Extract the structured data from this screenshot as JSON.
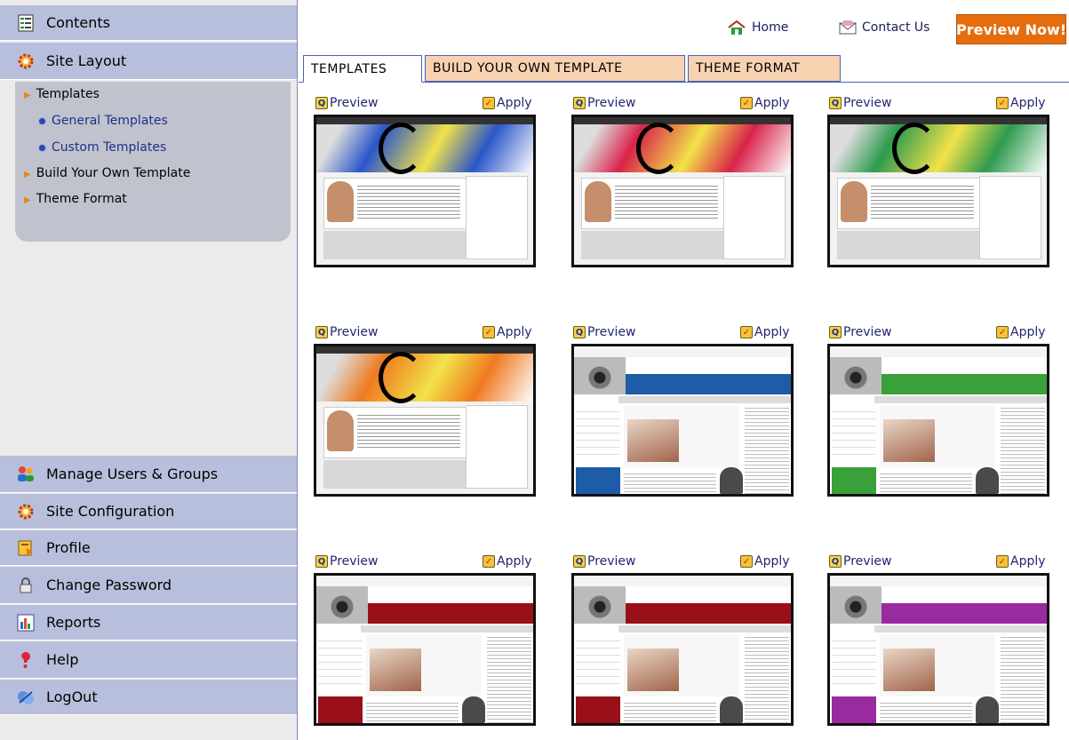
{
  "sidebar": {
    "contents": "Contents",
    "site_layout": "Site Layout",
    "submenu": {
      "templates": "Templates",
      "general_templates": "General Templates",
      "custom_templates": "Custom Templates",
      "build_your_own": "Build Your Own Template",
      "theme_format": "Theme Format"
    },
    "manage_users": "Manage Users & Groups",
    "site_configuration": "Site Configuration",
    "profile": "Profile",
    "change_password": "Change Password",
    "reports": "Reports",
    "help": "Help",
    "logout": "LogOut"
  },
  "topbar": {
    "home": "Home",
    "contact": "Contact Us",
    "preview_now": "Preview Now!"
  },
  "tabs": {
    "templates": "TEMPLATES",
    "build": "BUILD YOUR OWN TEMPLATE",
    "theme": "THEME FORMAT"
  },
  "card_labels": {
    "preview": "Preview",
    "apply": "Apply"
  },
  "colors": {
    "t1": "#2a56c9",
    "t2": "#d9234a",
    "t3": "#2e9a4e",
    "t4": "#ef7a1f",
    "t5": "#1e5ca8",
    "t6": "#3aa03a",
    "t7": "#9a1018",
    "t8": "#9a1018",
    "t9": "#9a2aa0"
  }
}
